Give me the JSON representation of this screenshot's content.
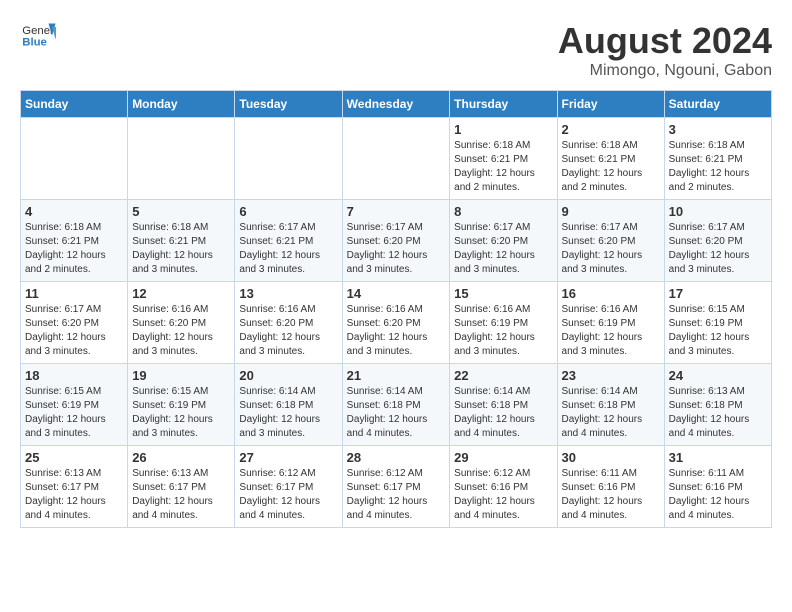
{
  "header": {
    "logo_general": "General",
    "logo_blue": "Blue",
    "main_title": "August 2024",
    "subtitle": "Mimongo, Ngouni, Gabon"
  },
  "weekdays": [
    "Sunday",
    "Monday",
    "Tuesday",
    "Wednesday",
    "Thursday",
    "Friday",
    "Saturday"
  ],
  "weeks": [
    [
      {
        "day": "",
        "info": ""
      },
      {
        "day": "",
        "info": ""
      },
      {
        "day": "",
        "info": ""
      },
      {
        "day": "",
        "info": ""
      },
      {
        "day": "1",
        "info": "Sunrise: 6:18 AM\nSunset: 6:21 PM\nDaylight: 12 hours\nand 2 minutes."
      },
      {
        "day": "2",
        "info": "Sunrise: 6:18 AM\nSunset: 6:21 PM\nDaylight: 12 hours\nand 2 minutes."
      },
      {
        "day": "3",
        "info": "Sunrise: 6:18 AM\nSunset: 6:21 PM\nDaylight: 12 hours\nand 2 minutes."
      }
    ],
    [
      {
        "day": "4",
        "info": "Sunrise: 6:18 AM\nSunset: 6:21 PM\nDaylight: 12 hours\nand 2 minutes."
      },
      {
        "day": "5",
        "info": "Sunrise: 6:18 AM\nSunset: 6:21 PM\nDaylight: 12 hours\nand 3 minutes."
      },
      {
        "day": "6",
        "info": "Sunrise: 6:17 AM\nSunset: 6:21 PM\nDaylight: 12 hours\nand 3 minutes."
      },
      {
        "day": "7",
        "info": "Sunrise: 6:17 AM\nSunset: 6:20 PM\nDaylight: 12 hours\nand 3 minutes."
      },
      {
        "day": "8",
        "info": "Sunrise: 6:17 AM\nSunset: 6:20 PM\nDaylight: 12 hours\nand 3 minutes."
      },
      {
        "day": "9",
        "info": "Sunrise: 6:17 AM\nSunset: 6:20 PM\nDaylight: 12 hours\nand 3 minutes."
      },
      {
        "day": "10",
        "info": "Sunrise: 6:17 AM\nSunset: 6:20 PM\nDaylight: 12 hours\nand 3 minutes."
      }
    ],
    [
      {
        "day": "11",
        "info": "Sunrise: 6:17 AM\nSunset: 6:20 PM\nDaylight: 12 hours\nand 3 minutes."
      },
      {
        "day": "12",
        "info": "Sunrise: 6:16 AM\nSunset: 6:20 PM\nDaylight: 12 hours\nand 3 minutes."
      },
      {
        "day": "13",
        "info": "Sunrise: 6:16 AM\nSunset: 6:20 PM\nDaylight: 12 hours\nand 3 minutes."
      },
      {
        "day": "14",
        "info": "Sunrise: 6:16 AM\nSunset: 6:20 PM\nDaylight: 12 hours\nand 3 minutes."
      },
      {
        "day": "15",
        "info": "Sunrise: 6:16 AM\nSunset: 6:19 PM\nDaylight: 12 hours\nand 3 minutes."
      },
      {
        "day": "16",
        "info": "Sunrise: 6:16 AM\nSunset: 6:19 PM\nDaylight: 12 hours\nand 3 minutes."
      },
      {
        "day": "17",
        "info": "Sunrise: 6:15 AM\nSunset: 6:19 PM\nDaylight: 12 hours\nand 3 minutes."
      }
    ],
    [
      {
        "day": "18",
        "info": "Sunrise: 6:15 AM\nSunset: 6:19 PM\nDaylight: 12 hours\nand 3 minutes."
      },
      {
        "day": "19",
        "info": "Sunrise: 6:15 AM\nSunset: 6:19 PM\nDaylight: 12 hours\nand 3 minutes."
      },
      {
        "day": "20",
        "info": "Sunrise: 6:14 AM\nSunset: 6:18 PM\nDaylight: 12 hours\nand 3 minutes."
      },
      {
        "day": "21",
        "info": "Sunrise: 6:14 AM\nSunset: 6:18 PM\nDaylight: 12 hours\nand 4 minutes."
      },
      {
        "day": "22",
        "info": "Sunrise: 6:14 AM\nSunset: 6:18 PM\nDaylight: 12 hours\nand 4 minutes."
      },
      {
        "day": "23",
        "info": "Sunrise: 6:14 AM\nSunset: 6:18 PM\nDaylight: 12 hours\nand 4 minutes."
      },
      {
        "day": "24",
        "info": "Sunrise: 6:13 AM\nSunset: 6:18 PM\nDaylight: 12 hours\nand 4 minutes."
      }
    ],
    [
      {
        "day": "25",
        "info": "Sunrise: 6:13 AM\nSunset: 6:17 PM\nDaylight: 12 hours\nand 4 minutes."
      },
      {
        "day": "26",
        "info": "Sunrise: 6:13 AM\nSunset: 6:17 PM\nDaylight: 12 hours\nand 4 minutes."
      },
      {
        "day": "27",
        "info": "Sunrise: 6:12 AM\nSunset: 6:17 PM\nDaylight: 12 hours\nand 4 minutes."
      },
      {
        "day": "28",
        "info": "Sunrise: 6:12 AM\nSunset: 6:17 PM\nDaylight: 12 hours\nand 4 minutes."
      },
      {
        "day": "29",
        "info": "Sunrise: 6:12 AM\nSunset: 6:16 PM\nDaylight: 12 hours\nand 4 minutes."
      },
      {
        "day": "30",
        "info": "Sunrise: 6:11 AM\nSunset: 6:16 PM\nDaylight: 12 hours\nand 4 minutes."
      },
      {
        "day": "31",
        "info": "Sunrise: 6:11 AM\nSunset: 6:16 PM\nDaylight: 12 hours\nand 4 minutes."
      }
    ]
  ]
}
